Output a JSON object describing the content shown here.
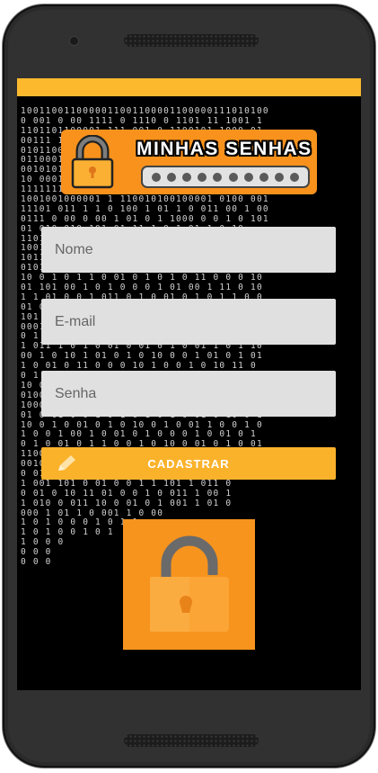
{
  "logo": {
    "title": "MINHAS SENHAS",
    "dot_count": 10
  },
  "form": {
    "nome_placeholder": "Nome",
    "email_placeholder": "E-mail",
    "senha_placeholder": "Senha",
    "submit_label": "CADASTRAR"
  },
  "matrix_rows": [
    "1001100110000011001100001100000111010100",
    "0 001 0 00 1111 0 1110 0 1101 11 1001 1",
    "1101101100001 111 001 0 1100101 1000 01",
    "00111 1 0 10 10 1001 00 0100 1 010 0101",
    "0101100001 0101 001 0100 001 000010101",
    "0110001110 1100 1110 11 1 1 1 011 0111",
    "0010101 001 0011 001 0 010 001 011 0100",
    "10 0001001 000101001 1010 0110101 0 0",
    "1111111111111111010101111000111110011 10",
    "1001001000001 1 110010100100001 0100 001",
    "11101 011 1 1 0 100 1 01 1 0 011 00 1 00",
    "0111 0 00 0 00 1 01 0 1 1000 0 0 1 0 101",
    "01 010 010 101 01 11 1 0 1 01 1 0 10",
    "1101 0 1 0 1 00 0 1 1 0 100 1 00 01 0 1",
    "1001110011010110100011100001110110011101",
    "1011110111101011101111 100111 01 0 1 01",
    "0101 100 01 0 101 0 1 1 0 0 1 0100 0 01",
    "10 0 1 0 1 1 0 01 0 1 0 1 0 11 0 0 0 10",
    "01 101 00 1 0 1 0 0 0 1 01 00 1 11 0 10",
    "1 1 01 0 0 1 011 0 1 0 01 0 1 0 1 1 0 0",
    "01 0 0 1 10 0 11 0 00 01 1 0 10 01 0 1 0",
    "101 0 1 011 0 011 001 0 010 010 1 10 1",
    "0001001 0 010110 0 01 1001 0 01 00 1 0",
    "0 1 0101001001000101001100001010010 0001",
    "1 011 1 0 1 0 01 0 01 0 1 0 01 1 0 1 10",
    "00 1 0 10 1 01 0 1 0 10 0 0 1 01 0 1 01",
    "1 0 01 0 11 0 0 0 10 1 0 0 1 0 10 11 0",
    "0 1 0 01 0 01 1 0 1 01 0 10 0 01 10 1 0",
    "10 0 1 1 0 10 0 1 0 0 0 1 1 01 0 1 0 01",
    "0100000011100110000 0001110000000110001",
    "10001101111100011 0011 11110111000111000",
    "01 0 01 0 0 1 0 1 0 1 0 1 0 01 0 10 0 1",
    "10 0 1 0 01 0 1 0 10 0 1 0 01 1 0 0 1 0",
    "1 0 0 1 00 1 0 01 0 1 0 0 0 1 0 01 0 1",
    "0 1 0 01 0 1 1 0 0 1 0 10 0 01 0 1 0 01",
    "110000 00110110 00010 1 101 110 00 0000",
    "0010101 011 11 01 1001 0 100 01 0 10110",
    "0 0101 00001 0 0101 1 101 1 101 00001",
    "1 001 101 0 01 0 0 1 1 101 1 011 0",
    "0 01 0 10 11 01 0 0 1 0 011 1 00 1",
    "1 010 0 011 10 0 01 0 1 001 1 01 0",
    "000 1 01 1 0 001 1 0 00",
    "1 0 1 0 0 0 1 0 1 1",
    "1 0 1 0 0 1 0 1",
    "1 0 0 0",
    "0 0 0",
    "0 0 0"
  ],
  "colors": {
    "status_bar": "#fdb92e",
    "logo_bg": "#f9921c",
    "field_bg": "#e0e0e0",
    "button_bg": "#fbb22b",
    "big_lock_bg": "#f7941d"
  },
  "icons": {
    "logo": "padlock-icon",
    "button": "pencil-icon",
    "bottom": "open-padlock-icon"
  }
}
